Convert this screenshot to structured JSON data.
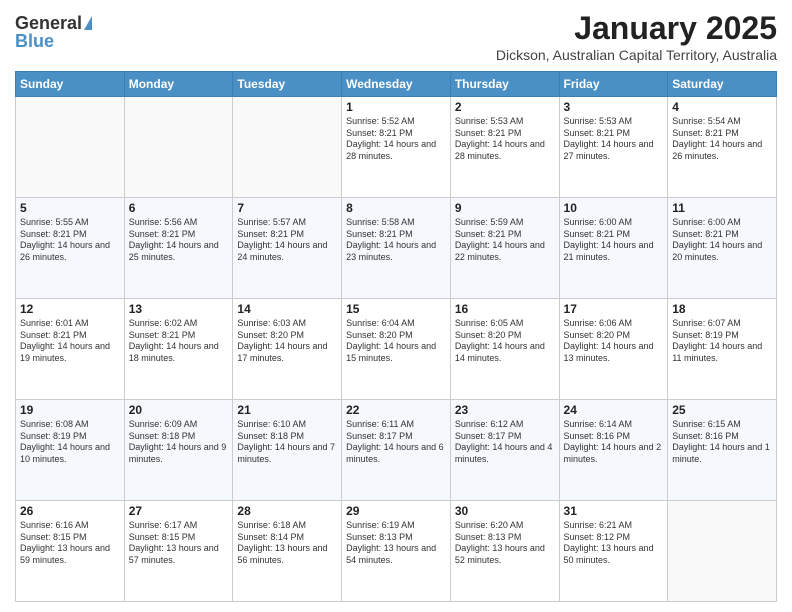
{
  "logo": {
    "general": "General",
    "blue": "Blue"
  },
  "title": "January 2025",
  "subtitle": "Dickson, Australian Capital Territory, Australia",
  "days_header": [
    "Sunday",
    "Monday",
    "Tuesday",
    "Wednesday",
    "Thursday",
    "Friday",
    "Saturday"
  ],
  "weeks": [
    [
      {
        "day": "",
        "info": ""
      },
      {
        "day": "",
        "info": ""
      },
      {
        "day": "",
        "info": ""
      },
      {
        "day": "1",
        "info": "Sunrise: 5:52 AM\nSunset: 8:21 PM\nDaylight: 14 hours\nand 28 minutes."
      },
      {
        "day": "2",
        "info": "Sunrise: 5:53 AM\nSunset: 8:21 PM\nDaylight: 14 hours\nand 28 minutes."
      },
      {
        "day": "3",
        "info": "Sunrise: 5:53 AM\nSunset: 8:21 PM\nDaylight: 14 hours\nand 27 minutes."
      },
      {
        "day": "4",
        "info": "Sunrise: 5:54 AM\nSunset: 8:21 PM\nDaylight: 14 hours\nand 26 minutes."
      }
    ],
    [
      {
        "day": "5",
        "info": "Sunrise: 5:55 AM\nSunset: 8:21 PM\nDaylight: 14 hours\nand 26 minutes."
      },
      {
        "day": "6",
        "info": "Sunrise: 5:56 AM\nSunset: 8:21 PM\nDaylight: 14 hours\nand 25 minutes."
      },
      {
        "day": "7",
        "info": "Sunrise: 5:57 AM\nSunset: 8:21 PM\nDaylight: 14 hours\nand 24 minutes."
      },
      {
        "day": "8",
        "info": "Sunrise: 5:58 AM\nSunset: 8:21 PM\nDaylight: 14 hours\nand 23 minutes."
      },
      {
        "day": "9",
        "info": "Sunrise: 5:59 AM\nSunset: 8:21 PM\nDaylight: 14 hours\nand 22 minutes."
      },
      {
        "day": "10",
        "info": "Sunrise: 6:00 AM\nSunset: 8:21 PM\nDaylight: 14 hours\nand 21 minutes."
      },
      {
        "day": "11",
        "info": "Sunrise: 6:00 AM\nSunset: 8:21 PM\nDaylight: 14 hours\nand 20 minutes."
      }
    ],
    [
      {
        "day": "12",
        "info": "Sunrise: 6:01 AM\nSunset: 8:21 PM\nDaylight: 14 hours\nand 19 minutes."
      },
      {
        "day": "13",
        "info": "Sunrise: 6:02 AM\nSunset: 8:21 PM\nDaylight: 14 hours\nand 18 minutes."
      },
      {
        "day": "14",
        "info": "Sunrise: 6:03 AM\nSunset: 8:20 PM\nDaylight: 14 hours\nand 17 minutes."
      },
      {
        "day": "15",
        "info": "Sunrise: 6:04 AM\nSunset: 8:20 PM\nDaylight: 14 hours\nand 15 minutes."
      },
      {
        "day": "16",
        "info": "Sunrise: 6:05 AM\nSunset: 8:20 PM\nDaylight: 14 hours\nand 14 minutes."
      },
      {
        "day": "17",
        "info": "Sunrise: 6:06 AM\nSunset: 8:20 PM\nDaylight: 14 hours\nand 13 minutes."
      },
      {
        "day": "18",
        "info": "Sunrise: 6:07 AM\nSunset: 8:19 PM\nDaylight: 14 hours\nand 11 minutes."
      }
    ],
    [
      {
        "day": "19",
        "info": "Sunrise: 6:08 AM\nSunset: 8:19 PM\nDaylight: 14 hours\nand 10 minutes."
      },
      {
        "day": "20",
        "info": "Sunrise: 6:09 AM\nSunset: 8:18 PM\nDaylight: 14 hours\nand 9 minutes."
      },
      {
        "day": "21",
        "info": "Sunrise: 6:10 AM\nSunset: 8:18 PM\nDaylight: 14 hours\nand 7 minutes."
      },
      {
        "day": "22",
        "info": "Sunrise: 6:11 AM\nSunset: 8:17 PM\nDaylight: 14 hours\nand 6 minutes."
      },
      {
        "day": "23",
        "info": "Sunrise: 6:12 AM\nSunset: 8:17 PM\nDaylight: 14 hours\nand 4 minutes."
      },
      {
        "day": "24",
        "info": "Sunrise: 6:14 AM\nSunset: 8:16 PM\nDaylight: 14 hours\nand 2 minutes."
      },
      {
        "day": "25",
        "info": "Sunrise: 6:15 AM\nSunset: 8:16 PM\nDaylight: 14 hours\nand 1 minute."
      }
    ],
    [
      {
        "day": "26",
        "info": "Sunrise: 6:16 AM\nSunset: 8:15 PM\nDaylight: 13 hours\nand 59 minutes."
      },
      {
        "day": "27",
        "info": "Sunrise: 6:17 AM\nSunset: 8:15 PM\nDaylight: 13 hours\nand 57 minutes."
      },
      {
        "day": "28",
        "info": "Sunrise: 6:18 AM\nSunset: 8:14 PM\nDaylight: 13 hours\nand 56 minutes."
      },
      {
        "day": "29",
        "info": "Sunrise: 6:19 AM\nSunset: 8:13 PM\nDaylight: 13 hours\nand 54 minutes."
      },
      {
        "day": "30",
        "info": "Sunrise: 6:20 AM\nSunset: 8:13 PM\nDaylight: 13 hours\nand 52 minutes."
      },
      {
        "day": "31",
        "info": "Sunrise: 6:21 AM\nSunset: 8:12 PM\nDaylight: 13 hours\nand 50 minutes."
      },
      {
        "day": "",
        "info": ""
      }
    ]
  ]
}
